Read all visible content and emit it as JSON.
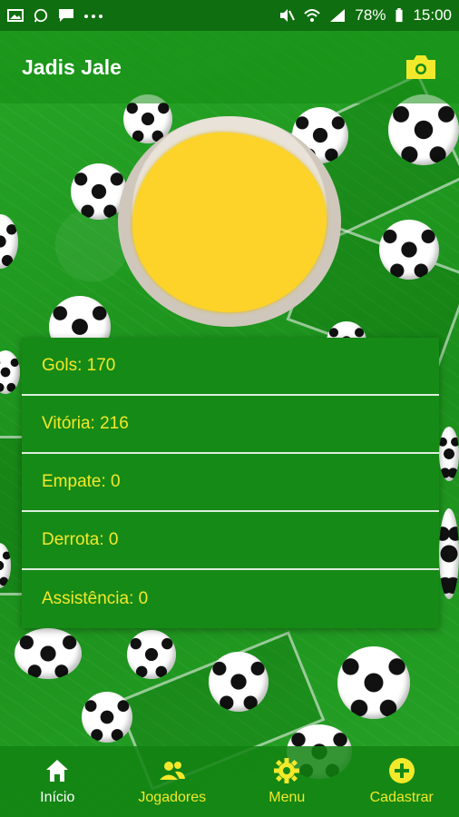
{
  "status_bar": {
    "battery": "78%",
    "time": "15:00",
    "left_icons": [
      "image-icon",
      "whatsapp-icon",
      "message-icon",
      "more-dots-icon"
    ],
    "right_icons": [
      "mute-icon",
      "wifi-icon",
      "signal-icon",
      "battery-icon"
    ]
  },
  "app_bar": {
    "title": "Jadis Jale",
    "camera_icon": "camera-icon"
  },
  "stats": {
    "gols": "Gols: 170",
    "vitoria": "Vitória: 216",
    "empate": "Empate: 0",
    "derrota": "Derrota: 0",
    "assistencia": "Assistência: 0"
  },
  "bottom_nav": {
    "items": [
      {
        "label": "Início",
        "icon": "home-icon",
        "active": true
      },
      {
        "label": "Jogadores",
        "icon": "players-icon",
        "active": false
      },
      {
        "label": "Menu",
        "icon": "gear-icon",
        "active": false
      },
      {
        "label": "Cadastrar",
        "icon": "add-icon",
        "active": false
      }
    ]
  },
  "colors": {
    "accent_yellow": "#f3e92b",
    "primary_green": "#168a16",
    "statusbar_green": "#0f6e0f"
  }
}
